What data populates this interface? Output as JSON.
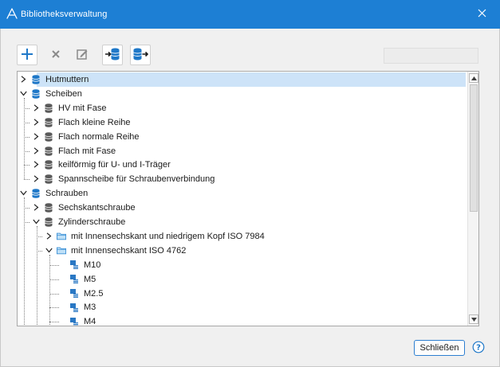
{
  "window": {
    "title": "Bibliotheksverwaltung",
    "close_icon": "close-icon",
    "app_icon": "app-triangle-icon"
  },
  "toolbar": {
    "buttons": [
      {
        "name": "add",
        "icon": "plus-icon",
        "enabled": true
      },
      {
        "name": "delete",
        "icon": "x-icon",
        "enabled": false
      },
      {
        "name": "edit",
        "icon": "edit-icon",
        "enabled": false
      },
      {
        "name": "import",
        "icon": "database-import-icon",
        "enabled": true
      },
      {
        "name": "export",
        "icon": "database-export-icon",
        "enabled": true
      }
    ],
    "search": {
      "value": "",
      "placeholder": ""
    }
  },
  "tree": {
    "rows": [
      {
        "label": "Hutmuttern",
        "level": 0,
        "state": "collapsed",
        "icon": "database-icon",
        "selected": true
      },
      {
        "label": "Scheiben",
        "level": 0,
        "state": "expanded",
        "icon": "database-icon"
      },
      {
        "label": "HV mit Fase",
        "level": 1,
        "state": "collapsed",
        "icon": "database-icon"
      },
      {
        "label": "Flach kleine Reihe",
        "level": 1,
        "state": "collapsed",
        "icon": "database-icon"
      },
      {
        "label": "Flach normale Reihe",
        "level": 1,
        "state": "collapsed",
        "icon": "database-icon"
      },
      {
        "label": "Flach mit Fase",
        "level": 1,
        "state": "collapsed",
        "icon": "database-icon"
      },
      {
        "label": "keilförmig für U- und I-Träger",
        "level": 1,
        "state": "collapsed",
        "icon": "database-icon"
      },
      {
        "label": "Spannscheibe für Schraubenverbindung",
        "level": 1,
        "state": "collapsed",
        "icon": "database-icon"
      },
      {
        "label": "Schrauben",
        "level": 0,
        "state": "expanded",
        "icon": "database-icon"
      },
      {
        "label": "Sechskantschraube",
        "level": 1,
        "state": "collapsed",
        "icon": "database-icon"
      },
      {
        "label": "Zylinderschraube",
        "level": 1,
        "state": "expanded",
        "icon": "database-icon"
      },
      {
        "label": "mit Innensechskant und niedrigem Kopf ISO 7984",
        "level": 2,
        "state": "collapsed",
        "icon": "folder-icon"
      },
      {
        "label": "mit Innensechskant ISO 4762",
        "level": 2,
        "state": "expanded",
        "icon": "folder-icon"
      },
      {
        "label": "M10",
        "level": 3,
        "state": "leaf",
        "icon": "screw-icon"
      },
      {
        "label": "M5",
        "level": 3,
        "state": "leaf",
        "icon": "screw-icon"
      },
      {
        "label": "M2.5",
        "level": 3,
        "state": "leaf",
        "icon": "screw-icon"
      },
      {
        "label": "M3",
        "level": 3,
        "state": "leaf",
        "icon": "screw-icon"
      },
      {
        "label": "M4",
        "level": 3,
        "state": "leaf",
        "icon": "screw-icon"
      }
    ]
  },
  "footer": {
    "close_label": "Schließen",
    "help_icon": "help-icon"
  },
  "colors": {
    "titlebar": "#1d7fd4",
    "selection": "#cce4f7",
    "accent": "#2d7fd1"
  }
}
